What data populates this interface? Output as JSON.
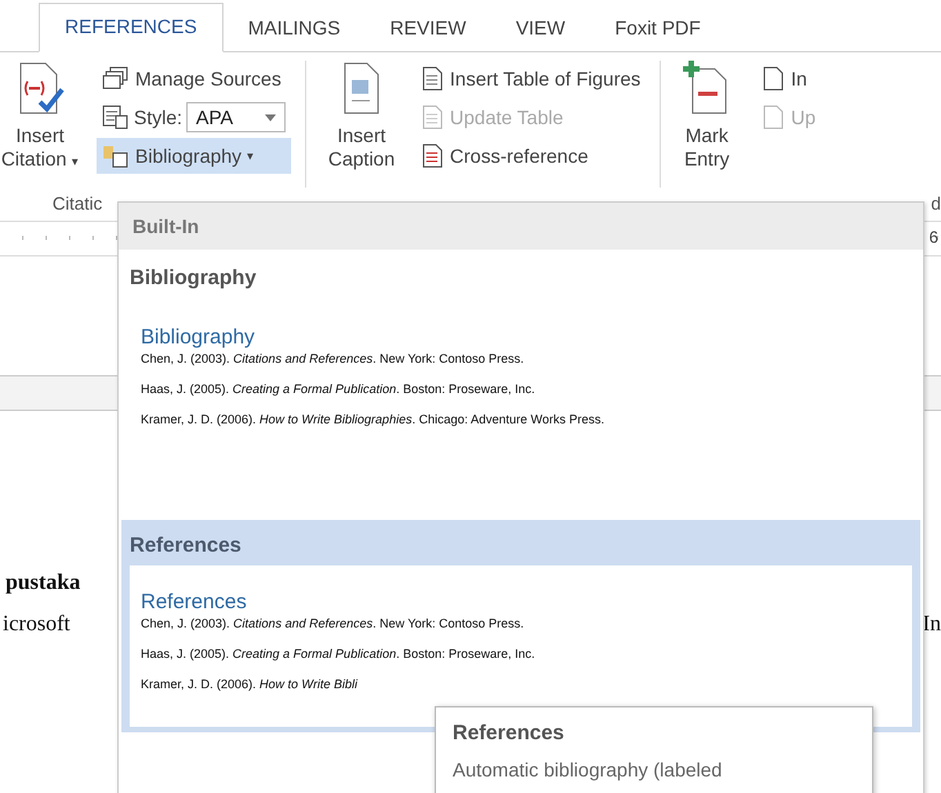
{
  "tabs": [
    {
      "label": "REFERENCES",
      "selected": true
    },
    {
      "label": "MAILINGS",
      "selected": false
    },
    {
      "label": "REVIEW",
      "selected": false
    },
    {
      "label": "VIEW",
      "selected": false
    },
    {
      "label": "Foxit PDF",
      "selected": false
    }
  ],
  "ribbon": {
    "insert_citation": {
      "line_1": "Insert",
      "line_2": "Citation",
      "caret": "▾"
    },
    "manage_sources": "Manage Sources",
    "style_label": "Style:",
    "style_value": "APA",
    "bibliography": {
      "label": "Bibliography",
      "caret": "▾",
      "open": true
    },
    "insert_caption": {
      "line_1": "Insert",
      "line_2": "Caption"
    },
    "insert_table_of_figures": {
      "label": "Insert Table of Figures",
      "disabled": false
    },
    "update_table": {
      "label": "Update Table",
      "disabled": true
    },
    "cross_reference": {
      "label": "Cross-reference",
      "disabled": false
    },
    "mark_entry": {
      "line_1": "Mark",
      "line_2": "Entry"
    },
    "insert_index": {
      "label": "In",
      "disabled": false
    },
    "update_index": {
      "label": "Up",
      "disabled": true
    },
    "group_labels": [
      "Citatic",
      "d"
    ]
  },
  "ruler": {
    "mark": "6"
  },
  "document": {
    "heading": "pustaka",
    "line_start": "icrosoft",
    "line_end": "In"
  },
  "dropdown": {
    "header": "Built-In",
    "sections": [
      {
        "heading": "Bibliography",
        "hovered": false,
        "preview": {
          "title": "Bibliography",
          "entries": [
            "Chen, J. (2003). *Citations and References*. New York: Contoso Press.",
            "Haas, J. (2005). *Creating a Formal Publication*. Boston: Proseware, Inc.",
            "Kramer, J. D. (2006). *How to Write Bibliographies*. Chicago: Adventure Works Press."
          ]
        }
      },
      {
        "heading": "References",
        "hovered": true,
        "preview": {
          "title": "References",
          "entries": [
            "Chen, J. (2003). *Citations and References*. New York: Contoso Press.",
            "Haas, J. (2005). *Creating a Formal Publication*. Boston: Proseware, Inc.",
            "Kramer, J. D. (2006). *How to Write Bibli*"
          ]
        }
      }
    ]
  },
  "tooltip": {
    "title": "References",
    "description": "Automatic bibliography (labeled"
  }
}
